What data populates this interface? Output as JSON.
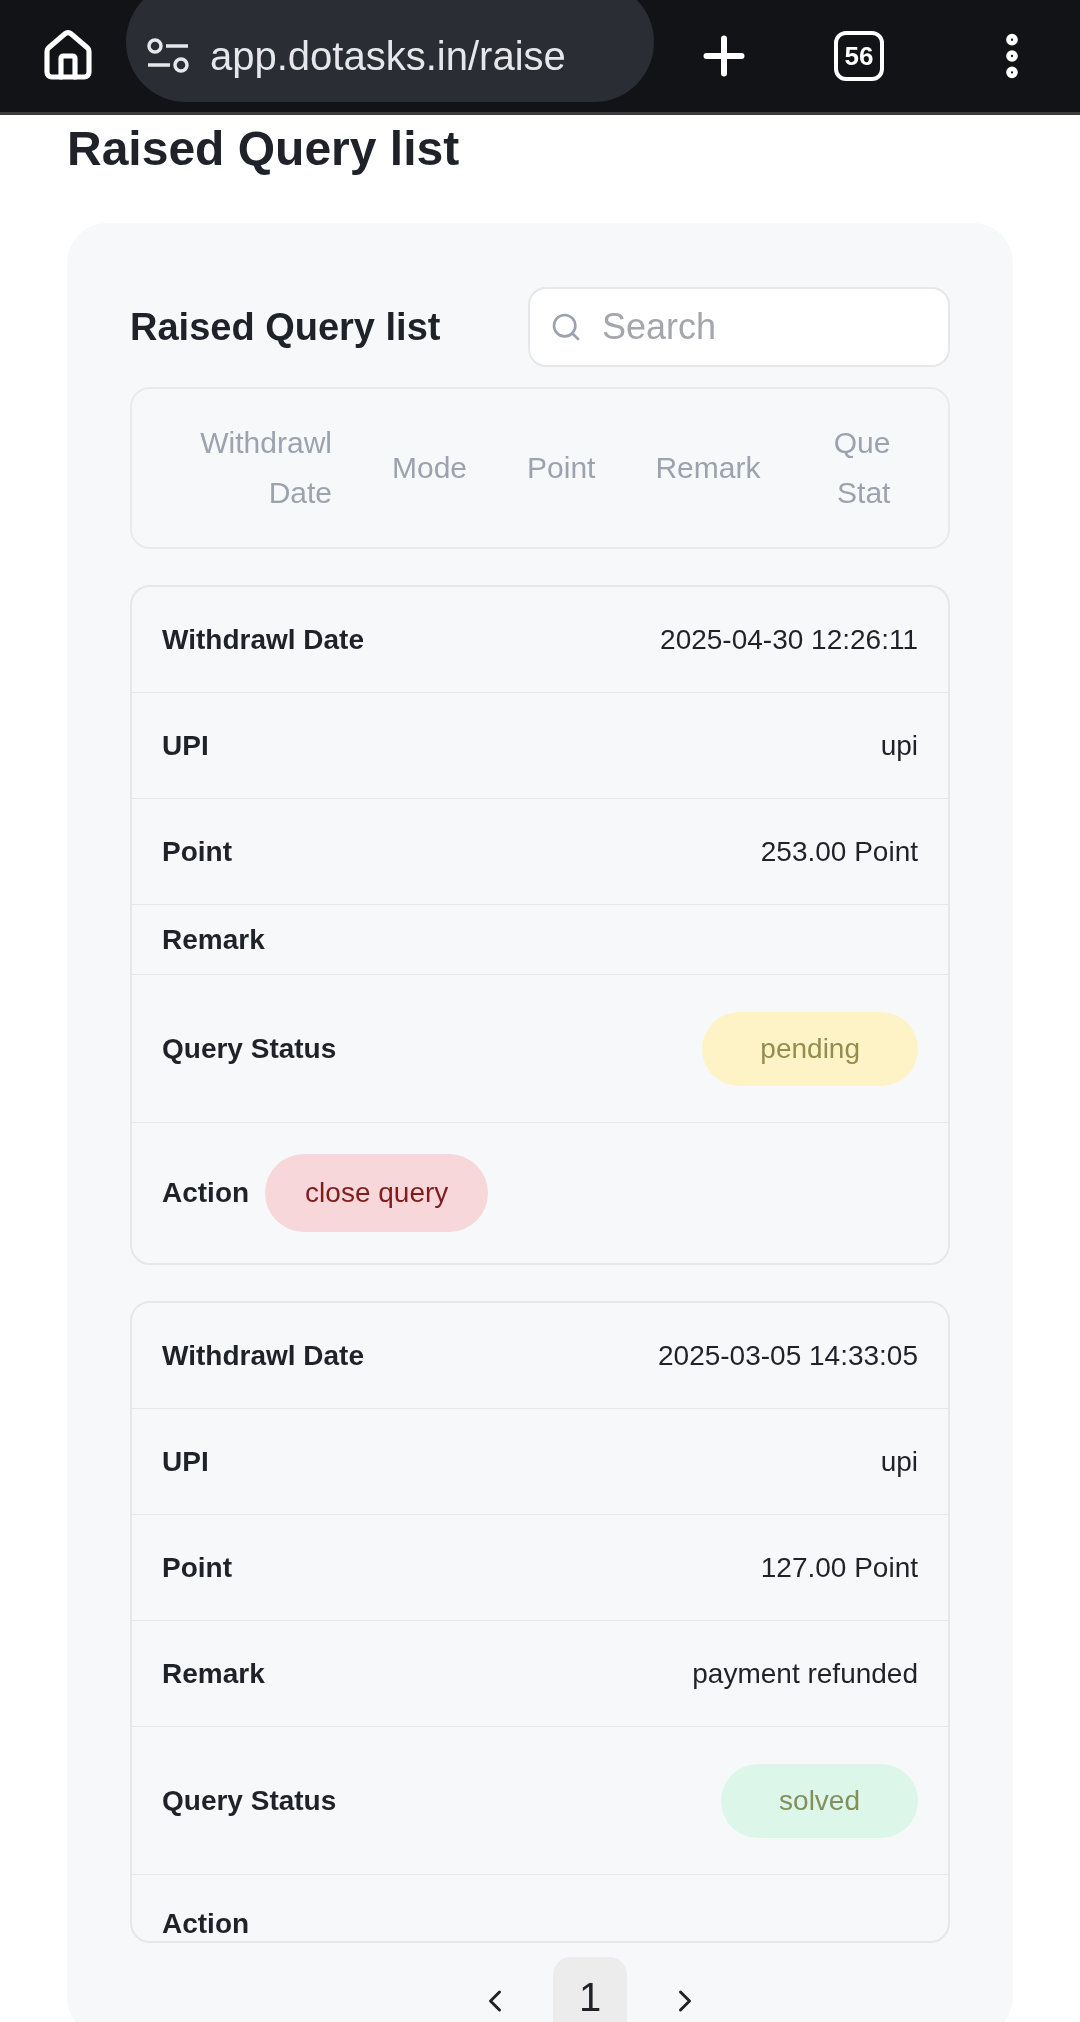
{
  "browser": {
    "url": "app.dotasks.in/raise",
    "tab_count": "56"
  },
  "page_title": "Raised Query list",
  "panel": {
    "title": "Raised Query list",
    "search": {
      "placeholder": "Search"
    },
    "table_columns": [
      "Withdrawl Date",
      "Mode",
      "Point",
      "Remark",
      "Que Stat"
    ],
    "cards": [
      {
        "fields": [
          {
            "kind": "text",
            "label": "Withdrawl Date",
            "value": "2025-04-30 12:26:11"
          },
          {
            "kind": "text",
            "label": "UPI",
            "value": "upi"
          },
          {
            "kind": "text",
            "label": "Point",
            "value": "253.00 Point"
          },
          {
            "kind": "empty",
            "label": "Remark"
          },
          {
            "kind": "status",
            "label": "Query Status",
            "value": "pending",
            "color": "#fef3c7"
          },
          {
            "kind": "action",
            "label": "Action",
            "button": "close query"
          }
        ]
      },
      {
        "fields": [
          {
            "kind": "text",
            "label": "Withdrawl Date",
            "value": "2025-03-05 14:33:05"
          },
          {
            "kind": "text",
            "label": "UPI",
            "value": "upi"
          },
          {
            "kind": "text",
            "label": "Point",
            "value": "127.00 Point"
          },
          {
            "kind": "text",
            "label": "Remark",
            "value": "payment refunded"
          },
          {
            "kind": "status",
            "label": "Query Status",
            "value": "solved",
            "color": "#dcf7e9"
          },
          {
            "kind": "cut",
            "label": "Action"
          }
        ]
      }
    ]
  },
  "pagination": {
    "pages": [
      {
        "label": "1",
        "selected": true
      }
    ]
  }
}
